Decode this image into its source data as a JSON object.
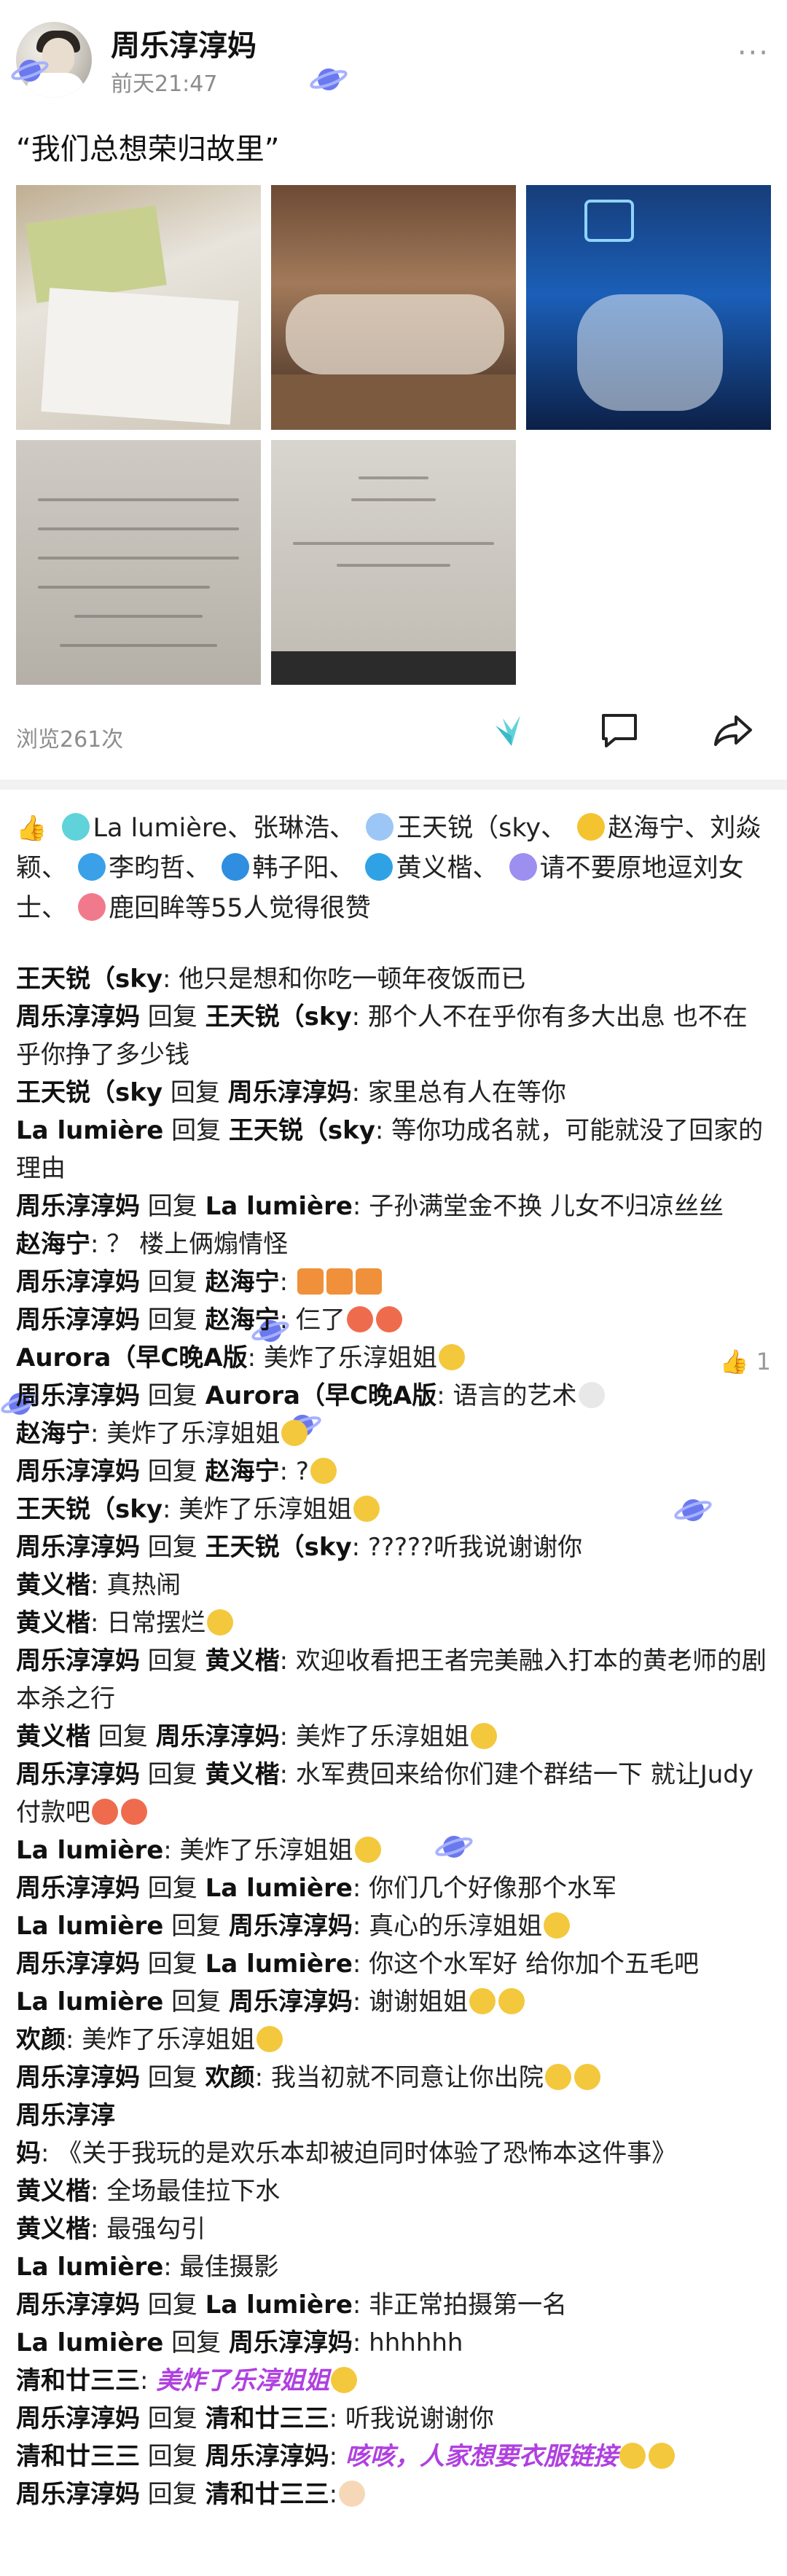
{
  "header": {
    "username": "周乐淳淳妈",
    "time": "前天21:47",
    "more_icon": "more-dots-icon"
  },
  "post": {
    "text": "“我们总想荣归故里”"
  },
  "stats": {
    "views": "浏览261次"
  },
  "likes": {
    "text_1": "La lumière、张琳浩、",
    "text_2": "王天锐（sky、",
    "text_3": "赵海宁、刘焱颖、",
    "text_4": "李昀哲、",
    "text_5": "韩子阳、",
    "text_6": "黄义楷、",
    "text_7": "请不要原地逗刘女士、",
    "text_8": "鹿回眸等55人觉得很赞"
  },
  "comments": [
    {
      "name": "王天锐（sky",
      "text": ": 他只是想和你吃一顿年夜饭而已"
    },
    {
      "name": "周乐淳淳妈",
      "mid": " 回复 ",
      "target": "王天锐（sky",
      "text": ": 那个人不在乎你有多大出息 也不在乎你挣了多少钱"
    },
    {
      "name": "王天锐（sky",
      "mid": " 回复 ",
      "target": "周乐淳淳妈",
      "text": ": 家里总有人在等你"
    },
    {
      "name": "La lumière",
      "mid": " 回复 ",
      "target": "王天锐（sky",
      "text": ": 等你功成名就，可能就没了回家的理由"
    },
    {
      "name": "周乐淳淳妈",
      "mid": " 回复 ",
      "target": "La lumière",
      "text": ": 子孙满堂金不换 儿女不归凉丝丝"
    },
    {
      "name": "赵海宁",
      "text": ": ？ 楼上俩煽情怪"
    },
    {
      "name": "周乐淳淳妈",
      "mid": " 回复 ",
      "target": "赵海宁",
      "text": ":"
    },
    {
      "name": "周乐淳淳妈",
      "mid": " 回复 ",
      "target": "赵海宁",
      "text": ": 仨了"
    },
    {
      "name": "Aurora（早C晚A版",
      "text": ": 美炸了乐淳姐姐"
    },
    {
      "name": "周乐淳淳妈",
      "mid": " 回复 ",
      "target": "Aurora（早C晚A版",
      "text": ": 语言的艺术"
    },
    {
      "name": "赵海宁",
      "text": ": 美炸了乐淳姐姐"
    },
    {
      "name": "周乐淳淳妈",
      "mid": " 回复 ",
      "target": "赵海宁",
      "text": ": ?"
    },
    {
      "name": "王天锐（sky",
      "text": ": 美炸了乐淳姐姐"
    },
    {
      "name": "周乐淳淳妈",
      "mid": " 回复 ",
      "target": "王天锐（sky",
      "text": ": ?????听我说谢谢你"
    },
    {
      "name": "黄义楷",
      "text": ": 真热闹"
    },
    {
      "name": "黄义楷",
      "text": ": 日常摆烂"
    },
    {
      "name": "周乐淳淳妈",
      "mid": " 回复 ",
      "target": "黄义楷",
      "text": ": 欢迎收看把王者完美融入打本的黄老师的剧本杀之行"
    },
    {
      "name": "黄义楷",
      "mid": " 回复 ",
      "target": "周乐淳淳妈",
      "text": ": 美炸了乐淳姐姐"
    },
    {
      "name": "周乐淳淳妈",
      "mid": " 回复 ",
      "target": "黄义楷",
      "text": ": 水军费回来给你们建个群结一下 就让Judy付款吧"
    },
    {
      "name": "La lumière",
      "text": ": 美炸了乐淳姐姐"
    },
    {
      "name": "周乐淳淳妈",
      "mid": " 回复 ",
      "target": "La lumière",
      "text": ": 你们几个好像那个水军"
    },
    {
      "name": "La lumière",
      "mid": " 回复 ",
      "target": "周乐淳淳妈",
      "text": ": 真心的乐淳姐姐"
    },
    {
      "name": "周乐淳淳妈",
      "mid": " 回复 ",
      "target": "La lumière",
      "text": ": 你这个水军好 给你加个五毛吧"
    },
    {
      "name": "La lumière",
      "mid": " 回复 ",
      "target": "周乐淳淳妈",
      "text": ": 谢谢姐姐"
    },
    {
      "name": "欢颜",
      "text": ": 美炸了乐淳姐姐"
    },
    {
      "name": "周乐淳淳妈",
      "mid": " 回复 ",
      "target": "欢颜",
      "text": ": 我当初就不同意让你出院"
    },
    {
      "name": "周乐淳淳妈",
      "text": ": 《关于我玩的是欢乐本却被迫同时体验了恐怖本这件事》"
    },
    {
      "name": "黄义楷",
      "text": ": 全场最佳拉下水"
    },
    {
      "name": "黄义楷",
      "text": ": 最强勾引"
    },
    {
      "name": "La lumière",
      "text": ": 最佳摄影"
    },
    {
      "name": "周乐淳淳妈",
      "mid": " 回复 ",
      "target": "La lumière",
      "text": ": 非正常拍摄第一名"
    },
    {
      "name": "La lumière",
      "mid": " 回复 ",
      "target": "周乐淳淳妈",
      "text": ": hhhhhh"
    },
    {
      "name": "清和廿三三",
      "text": ": ",
      "purple": "美炸了乐淳姐姐"
    },
    {
      "name": "周乐淳淳妈",
      "mid": " 回复 ",
      "target": "清和廿三三",
      "text": ": 听我说谢谢你"
    },
    {
      "name": "清和廿三三",
      "mid": " 回复 ",
      "target": "周乐淳淳妈",
      "text": ": ",
      "purple": "咳咳，人家想要衣服链接"
    },
    {
      "name": "周乐淳淳妈",
      "mid": " 回复 ",
      "target": "清和廿三三",
      "text": ":"
    }
  ],
  "like_count": "1",
  "colors": {
    "accent_purple": "#b040e0",
    "planet_blue": "#5b6ee8",
    "muted_gray": "#8c8c8c"
  }
}
